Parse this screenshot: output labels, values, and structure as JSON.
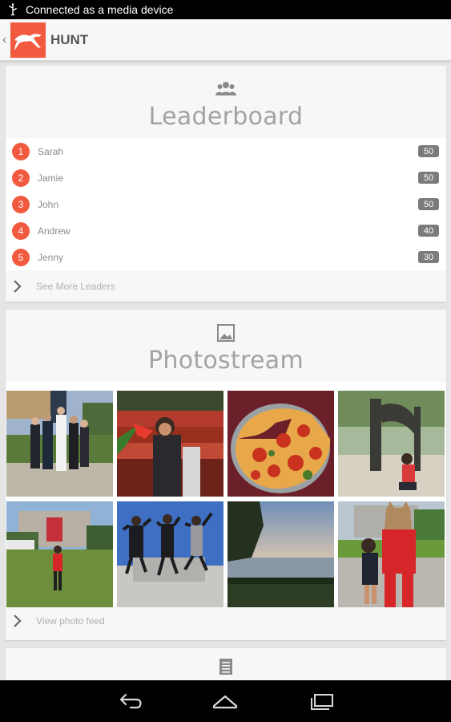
{
  "status_bar": {
    "notification": "Connected as a media device",
    "usb_icon": "usb-icon"
  },
  "action_bar": {
    "title": "HUNT",
    "up_icon": "up-caret-icon",
    "logo_icon": "cheetah-logo-icon"
  },
  "leaderboard": {
    "title": "Leaderboard",
    "icon": "group-icon",
    "entries": [
      {
        "rank": "1",
        "name": "Sarah",
        "score": "50"
      },
      {
        "rank": "2",
        "name": "Jamie",
        "score": "50"
      },
      {
        "rank": "3",
        "name": "John",
        "score": "50"
      },
      {
        "rank": "4",
        "name": "Andrew",
        "score": "40"
      },
      {
        "rank": "5",
        "name": "Jenny",
        "score": "30"
      }
    ],
    "more_link": "See More Leaders"
  },
  "photostream": {
    "title": "Photostream",
    "icon": "image-icon",
    "photos": [
      {
        "name": "photo-group-outdoor"
      },
      {
        "name": "photo-stadium-fan"
      },
      {
        "name": "photo-pizza"
      },
      {
        "name": "photo-statue"
      },
      {
        "name": "photo-building-lawn"
      },
      {
        "name": "photo-group-jumping"
      },
      {
        "name": "photo-lake-sunset"
      },
      {
        "name": "photo-mascot"
      }
    ],
    "more_link": "View photo feed"
  },
  "third_section": {
    "icon": "document-icon"
  },
  "nav_bar": {
    "back_icon": "back-icon",
    "home_icon": "home-icon",
    "recents_icon": "recents-icon"
  },
  "colors": {
    "accent": "#f15a3f",
    "badge": "#7b7b7b",
    "title_text": "#a3a3a3"
  }
}
